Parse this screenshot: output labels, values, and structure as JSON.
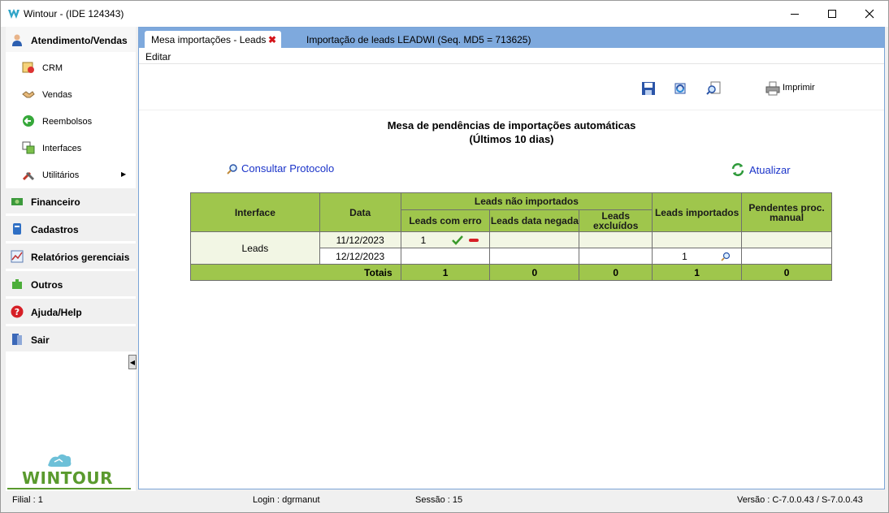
{
  "window": {
    "title": "Wintour - (IDE 124343)"
  },
  "sidebar": {
    "sections": [
      {
        "label": "Atendimento/Vendas",
        "icon": "user-icon"
      },
      {
        "label": "Financeiro",
        "icon": "money-icon"
      },
      {
        "label": "Cadastros",
        "icon": "database-icon"
      },
      {
        "label": "Relatórios gerenciais",
        "icon": "chart-icon"
      },
      {
        "label": "Outros",
        "icon": "puzzle-icon"
      },
      {
        "label": "Ajuda/Help",
        "icon": "help-icon"
      },
      {
        "label": "Sair",
        "icon": "exit-icon"
      }
    ],
    "items": [
      {
        "label": "CRM",
        "icon": "crm-icon"
      },
      {
        "label": "Vendas",
        "icon": "handshake-icon"
      },
      {
        "label": "Reembolsos",
        "icon": "back-arrow-icon"
      },
      {
        "label": "Interfaces",
        "icon": "interfaces-icon"
      },
      {
        "label": "Utilitários",
        "icon": "tools-icon"
      }
    ],
    "logo": "WINTOUR"
  },
  "tabs": [
    {
      "label": "Mesa importações - Leads",
      "active": true
    },
    {
      "label": "Importação de leads LEADWI (Seq. MD5 = 713625)",
      "active": false
    }
  ],
  "menu": {
    "edit": "Editar"
  },
  "toolbar": {
    "print": "Imprimir"
  },
  "report": {
    "title": "Mesa de pendências de importações automáticas",
    "subtitle": "(Últimos 10 dias)",
    "consult": "Consultar Protocolo",
    "refresh": "Atualizar"
  },
  "table": {
    "headers": {
      "interface": "Interface",
      "date": "Data",
      "not_imported": "Leads não importados",
      "with_error": "Leads com erro",
      "date_denied": "Leads data negada",
      "excluded": "Leads excluídos",
      "imported": "Leads importados",
      "pending": "Pendentes proc. manual"
    },
    "group": "Leads",
    "rows": [
      {
        "date": "11/12/2023",
        "with_error": "1",
        "date_denied": "",
        "excluded": "",
        "imported": "",
        "pending": ""
      },
      {
        "date": "12/12/2023",
        "with_error": "",
        "date_denied": "",
        "excluded": "",
        "imported": "1",
        "pending": ""
      }
    ],
    "totals": {
      "label": "Totais",
      "with_error": "1",
      "date_denied": "0",
      "excluded": "0",
      "imported": "1",
      "pending": "0"
    }
  },
  "status": {
    "branch": "Filial : 1",
    "login": "Login : dgrmanut",
    "session": "Sessão : 15",
    "version": "Versão : C-7.0.0.43 / S-7.0.0.43"
  }
}
